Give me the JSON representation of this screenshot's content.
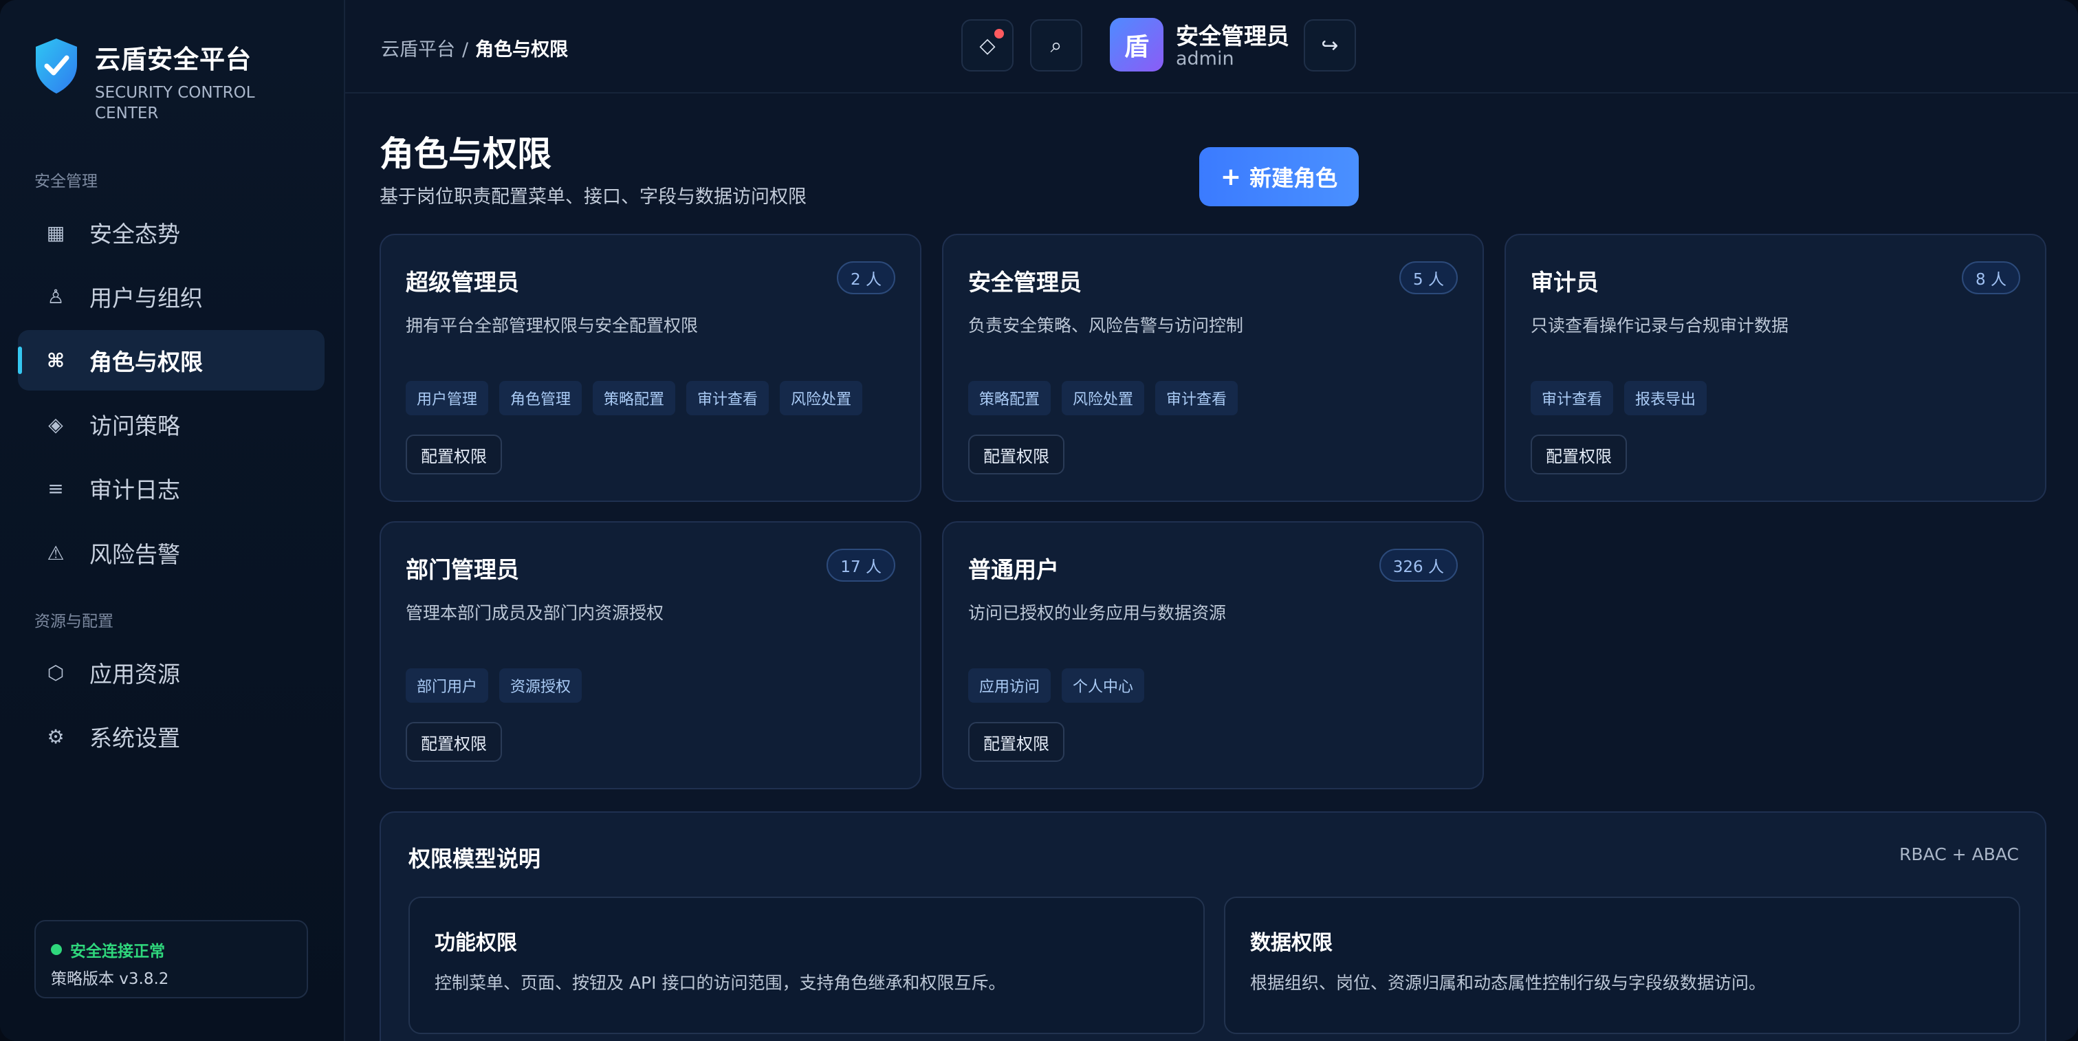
{
  "brand": {
    "name": "云盾安全平台",
    "subtitle": "SECURITY CONTROL CENTER"
  },
  "sidebar": {
    "section_security": "安全管理",
    "section_resources": "资源与配置",
    "items": [
      {
        "label": "安全态势",
        "icon": "▦"
      },
      {
        "label": "用户与组织",
        "icon": "♙"
      },
      {
        "label": "角色与权限",
        "icon": "⌘"
      },
      {
        "label": "访问策略",
        "icon": "◈"
      },
      {
        "label": "审计日志",
        "icon": "≡"
      },
      {
        "label": "风险告警",
        "icon": "⚠"
      },
      {
        "label": "应用资源",
        "icon": "⬡"
      },
      {
        "label": "系统设置",
        "icon": "⚙"
      }
    ],
    "status": {
      "text": "安全连接正常",
      "version": "策略版本 v3.8.2"
    }
  },
  "header": {
    "breadcrumb_root": "云盾平台",
    "breadcrumb_sep": "/",
    "breadcrumb_current": "角色与权限",
    "icons": {
      "alerts": "◇",
      "search": "⌕",
      "logout": "↪"
    },
    "user": {
      "avatar_char": "盾",
      "name": "安全管理员",
      "id": "admin"
    }
  },
  "page": {
    "title": "角色与权限",
    "description": "基于岗位职责配置菜单、接口、字段与数据访问权限",
    "new_role_plus": "+",
    "new_role_label": "新建角色"
  },
  "roles": [
    {
      "name": "超级管理员",
      "count": "2 人",
      "desc": "拥有平台全部管理权限与安全配置权限",
      "tags": [
        "用户管理",
        "角色管理",
        "策略配置",
        "审计查看",
        "风险处置"
      ],
      "action": "配置权限"
    },
    {
      "name": "安全管理员",
      "count": "5 人",
      "desc": "负责安全策略、风险告警与访问控制",
      "tags": [
        "策略配置",
        "风险处置",
        "审计查看"
      ],
      "action": "配置权限"
    },
    {
      "name": "审计员",
      "count": "8 人",
      "desc": "只读查看操作记录与合规审计数据",
      "tags": [
        "审计查看",
        "报表导出"
      ],
      "action": "配置权限"
    },
    {
      "name": "部门管理员",
      "count": "17 人",
      "desc": "管理本部门成员及部门内资源授权",
      "tags": [
        "部门用户",
        "资源授权"
      ],
      "action": "配置权限"
    },
    {
      "name": "普通用户",
      "count": "326 人",
      "desc": "访问已授权的业务应用与数据资源",
      "tags": [
        "应用访问",
        "个人中心"
      ],
      "action": "配置权限"
    }
  ],
  "model": {
    "title": "权限模型说明",
    "tag": "RBAC + ABAC",
    "cards": [
      {
        "title": "功能权限",
        "desc": "控制菜单、页面、按钮及 API 接口的访问范围，支持角色继承和权限互斥。"
      },
      {
        "title": "数据权限",
        "desc": "根据组织、岗位、资源归属和动态属性控制行级与字段级数据访问。"
      }
    ]
  },
  "colors": {
    "accent": "#3b7bff",
    "active_indicator": "#35c7f0",
    "success": "#2fd77c",
    "notification": "#ff5a5f"
  }
}
